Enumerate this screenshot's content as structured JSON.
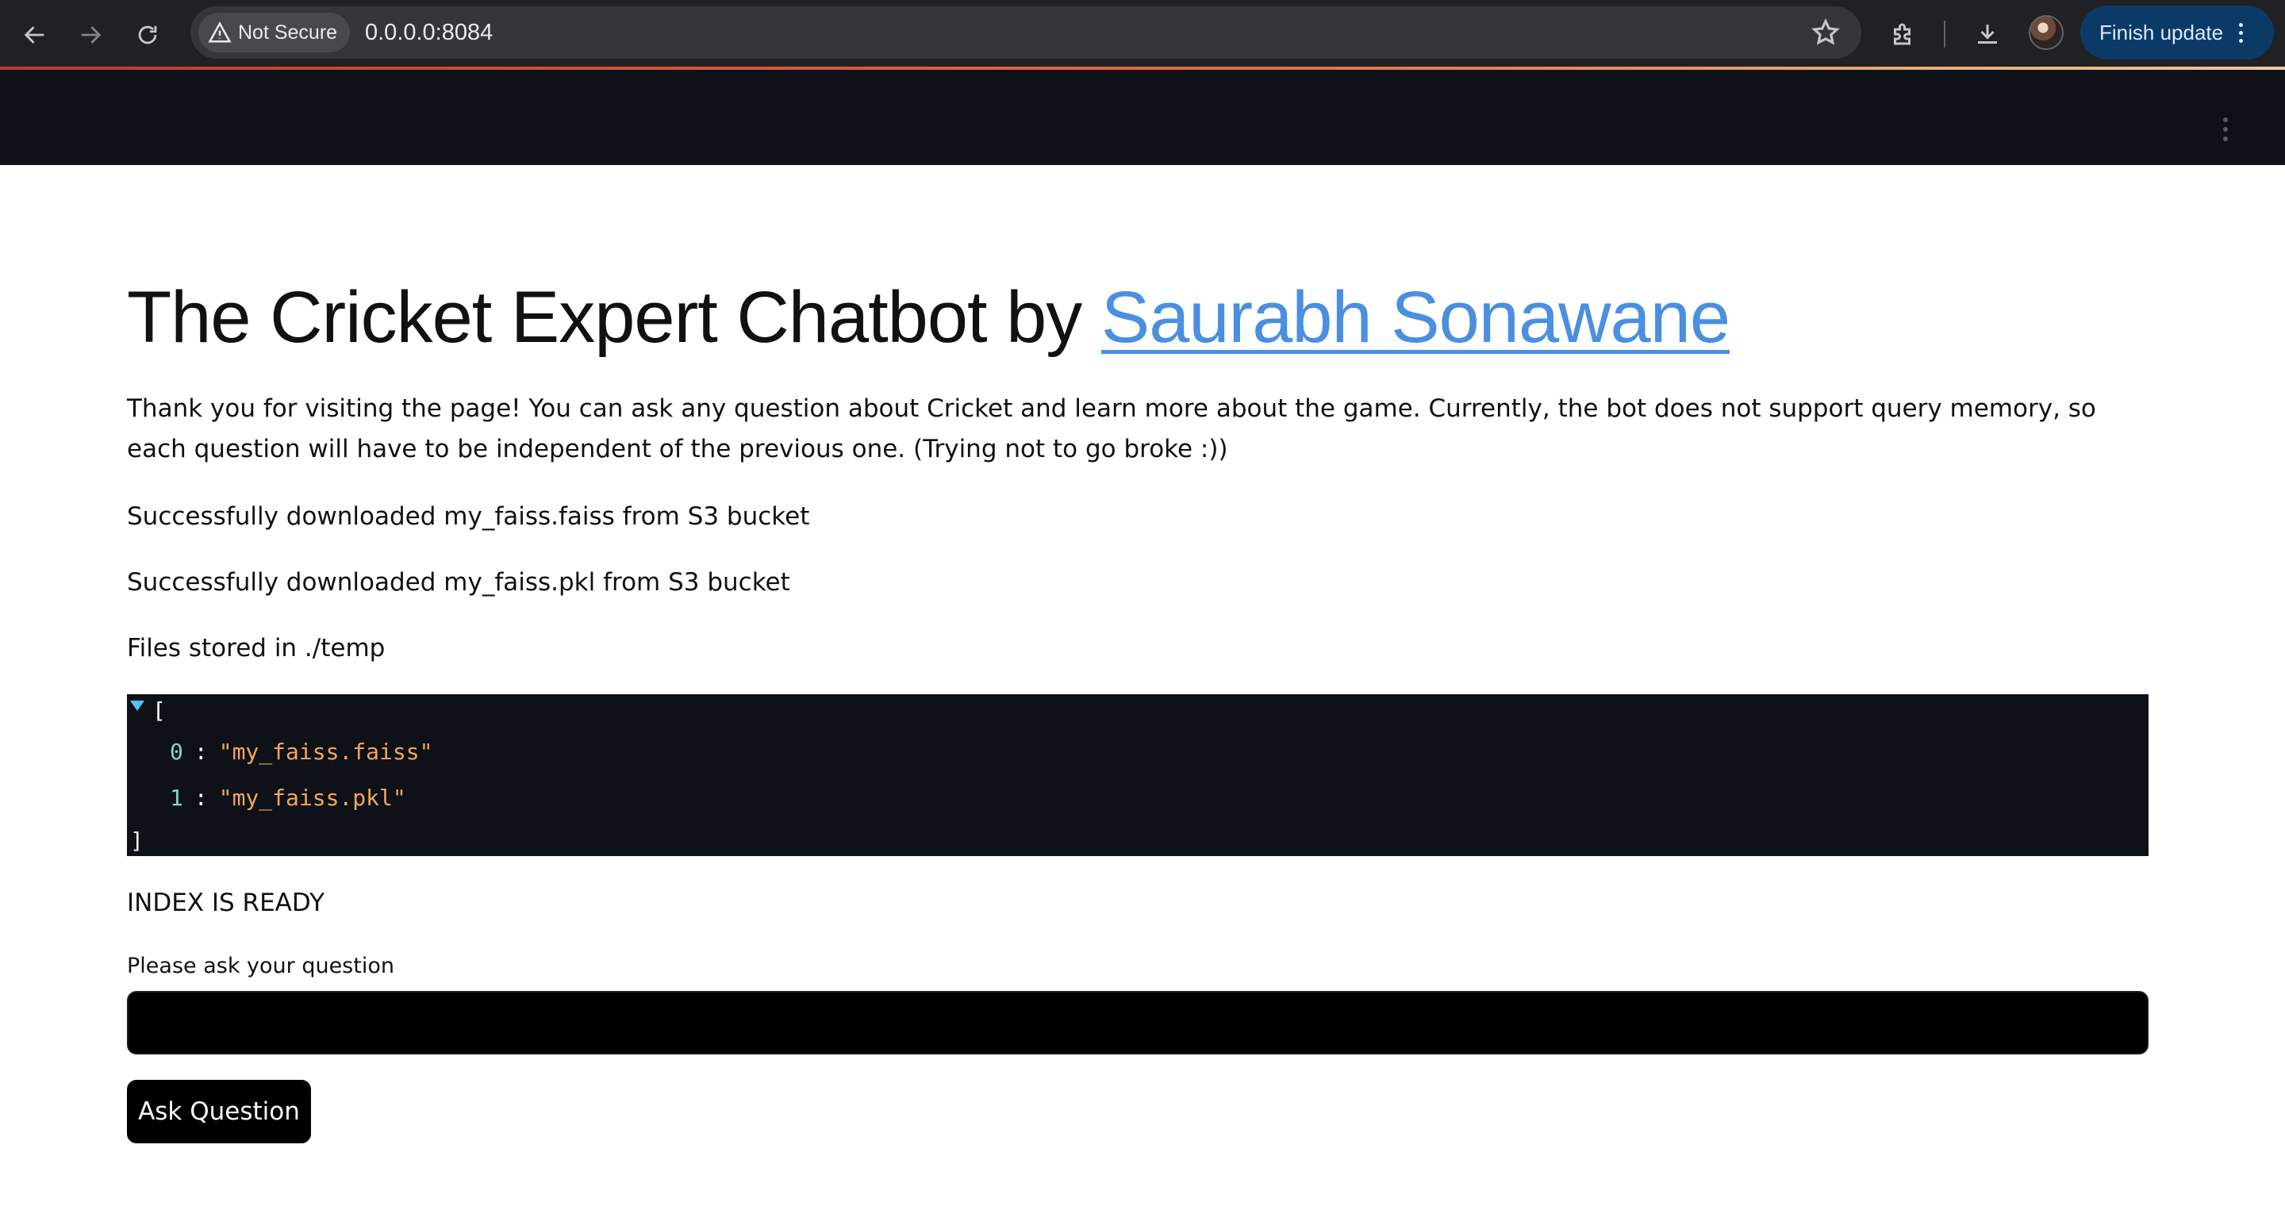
{
  "browser": {
    "security_label": "Not Secure",
    "url": "0.0.0.0:8084",
    "finish_update_label": "Finish update",
    "icons": {
      "back": "arrow-left-icon",
      "forward": "arrow-right-icon",
      "reload": "reload-icon",
      "warning": "warning-triangle-icon",
      "bookmark": "star-icon",
      "extensions": "puzzle-icon",
      "downloads": "download-icon",
      "menu": "kebab-menu-icon"
    },
    "colors": {
      "chrome_bg": "#202124",
      "finish_update_bg": "#0b3a66"
    }
  },
  "app": {
    "header_bg": "#0e1117",
    "title_prefix": "The Cricket Expert Chatbot by ",
    "title_link": "Saurabh Sonawane",
    "intro": "Thank you for visiting the page! You can ask any question about Cricket and learn more about the game. Currently, the bot does not support query memory, so each question will have to be independent of the previous one. (Trying not to go broke :))",
    "status_messages": {
      "faiss": "Successfully downloaded my_faiss.faiss from S3 bucket",
      "pkl": "Successfully downloaded my_faiss.pkl from S3 bucket",
      "files": "Files stored in ./temp"
    },
    "json_view": {
      "open_bracket": "[",
      "close_bracket": "]",
      "items": [
        {
          "index": "0",
          "value": "\"my_faiss.faiss\""
        },
        {
          "index": "1",
          "value": "\"my_faiss.pkl\""
        }
      ]
    },
    "index_ready": "INDEX IS READY",
    "question_label": "Please ask your question",
    "question_value": "",
    "ask_button_label": "Ask Question",
    "link_color": "#4a8fe0"
  }
}
